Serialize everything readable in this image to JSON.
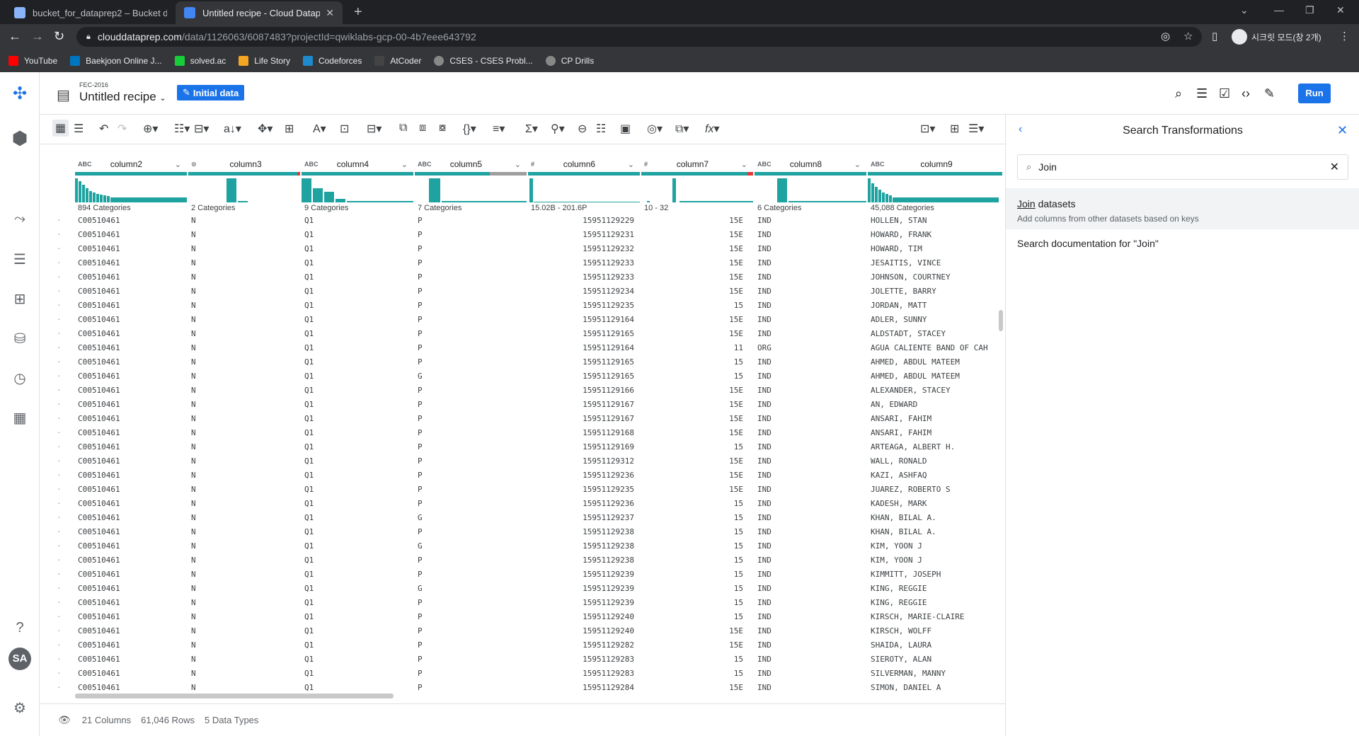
{
  "browser": {
    "tabs": [
      {
        "title": "bucket_for_dataprep2 – Bucket d",
        "active": false
      },
      {
        "title": "Untitled recipe - Cloud Dataprep",
        "active": true
      }
    ],
    "url_host": "clouddataprep.com",
    "url_path": "/data/1126063/6087483?projectId=qwiklabs-gcp-00-4b7eee643792",
    "profile_label": "시크릿 모드(창 2개)",
    "bookmarks": [
      "YouTube",
      "Baekjoon Online J...",
      "solved.ac",
      "Life Story",
      "Codeforces",
      "AtCoder",
      "CSES - CSES Probl...",
      "CP Drills"
    ]
  },
  "app": {
    "dataset_tag": "FEC-2016",
    "recipe_title": "Untitled recipe",
    "initial_data_label": "Initial data",
    "run_label": "Run",
    "avatar_initials": "SA"
  },
  "columns": [
    {
      "name": "column2",
      "type": "ABC",
      "summary": "894 Categories"
    },
    {
      "name": "column3",
      "type": "⊙",
      "summary": "2 Categories"
    },
    {
      "name": "column4",
      "type": "ABC",
      "summary": "9 Categories"
    },
    {
      "name": "column5",
      "type": "ABC",
      "summary": "7 Categories"
    },
    {
      "name": "column6",
      "type": "#",
      "summary": "15.02B - 201.6P"
    },
    {
      "name": "column7",
      "type": "#",
      "summary": "10 - 32"
    },
    {
      "name": "column8",
      "type": "ABC",
      "summary": "6 Categories"
    },
    {
      "name": "column9",
      "type": "ABC",
      "summary": "45,088 Categories"
    }
  ],
  "rows": [
    [
      "C00510461",
      "N",
      "Q1",
      "P",
      "15951129229",
      "15E",
      "IND",
      "HOLLEN, STAN"
    ],
    [
      "C00510461",
      "N",
      "Q1",
      "P",
      "15951129231",
      "15E",
      "IND",
      "HOWARD, FRANK"
    ],
    [
      "C00510461",
      "N",
      "Q1",
      "P",
      "15951129232",
      "15E",
      "IND",
      "HOWARD, TIM"
    ],
    [
      "C00510461",
      "N",
      "Q1",
      "P",
      "15951129233",
      "15E",
      "IND",
      "JESAITIS, VINCE"
    ],
    [
      "C00510461",
      "N",
      "Q1",
      "P",
      "15951129233",
      "15E",
      "IND",
      "JOHNSON, COURTNEY"
    ],
    [
      "C00510461",
      "N",
      "Q1",
      "P",
      "15951129234",
      "15E",
      "IND",
      "JOLETTE, BARRY"
    ],
    [
      "C00510461",
      "N",
      "Q1",
      "P",
      "15951129235",
      "15",
      "IND",
      "JORDAN, MATT"
    ],
    [
      "C00510461",
      "N",
      "Q1",
      "P",
      "15951129164",
      "15E",
      "IND",
      "ADLER, SUNNY"
    ],
    [
      "C00510461",
      "N",
      "Q1",
      "P",
      "15951129165",
      "15E",
      "IND",
      "ALDSTADT, STACEY"
    ],
    [
      "C00510461",
      "N",
      "Q1",
      "P",
      "15951129164",
      "11",
      "ORG",
      "AGUA CALIENTE BAND OF CAH"
    ],
    [
      "C00510461",
      "N",
      "Q1",
      "P",
      "15951129165",
      "15",
      "IND",
      "AHMED, ABDUL MATEEM"
    ],
    [
      "C00510461",
      "N",
      "Q1",
      "G",
      "15951129165",
      "15",
      "IND",
      "AHMED, ABDUL MATEEM"
    ],
    [
      "C00510461",
      "N",
      "Q1",
      "P",
      "15951129166",
      "15E",
      "IND",
      "ALEXANDER, STACEY"
    ],
    [
      "C00510461",
      "N",
      "Q1",
      "P",
      "15951129167",
      "15E",
      "IND",
      "AN, EDWARD"
    ],
    [
      "C00510461",
      "N",
      "Q1",
      "P",
      "15951129167",
      "15E",
      "IND",
      "ANSARI, FAHIM"
    ],
    [
      "C00510461",
      "N",
      "Q1",
      "P",
      "15951129168",
      "15E",
      "IND",
      "ANSARI, FAHIM"
    ],
    [
      "C00510461",
      "N",
      "Q1",
      "P",
      "15951129169",
      "15",
      "IND",
      "ARTEAGA, ALBERT H."
    ],
    [
      "C00510461",
      "N",
      "Q1",
      "P",
      "15951129312",
      "15E",
      "IND",
      "WALL, RONALD"
    ],
    [
      "C00510461",
      "N",
      "Q1",
      "P",
      "15951129236",
      "15E",
      "IND",
      "KAZI, ASHFAQ"
    ],
    [
      "C00510461",
      "N",
      "Q1",
      "P",
      "15951129235",
      "15E",
      "IND",
      "JUAREZ, ROBERTO S"
    ],
    [
      "C00510461",
      "N",
      "Q1",
      "P",
      "15951129236",
      "15",
      "IND",
      "KADESH, MARK"
    ],
    [
      "C00510461",
      "N",
      "Q1",
      "G",
      "15951129237",
      "15",
      "IND",
      "KHAN, BILAL A."
    ],
    [
      "C00510461",
      "N",
      "Q1",
      "P",
      "15951129238",
      "15",
      "IND",
      "KHAN, BILAL A."
    ],
    [
      "C00510461",
      "N",
      "Q1",
      "G",
      "15951129238",
      "15",
      "IND",
      "KIM, YOON J"
    ],
    [
      "C00510461",
      "N",
      "Q1",
      "P",
      "15951129238",
      "15",
      "IND",
      "KIM, YOON J"
    ],
    [
      "C00510461",
      "N",
      "Q1",
      "P",
      "15951129239",
      "15",
      "IND",
      "KIMMITT, JOSEPH"
    ],
    [
      "C00510461",
      "N",
      "Q1",
      "G",
      "15951129239",
      "15",
      "IND",
      "KING, REGGIE"
    ],
    [
      "C00510461",
      "N",
      "Q1",
      "P",
      "15951129239",
      "15",
      "IND",
      "KING, REGGIE"
    ],
    [
      "C00510461",
      "N",
      "Q1",
      "P",
      "15951129240",
      "15",
      "IND",
      "KIRSCH, MARIE-CLAIRE"
    ],
    [
      "C00510461",
      "N",
      "Q1",
      "P",
      "15951129240",
      "15E",
      "IND",
      "KIRSCH, WOLFF"
    ],
    [
      "C00510461",
      "N",
      "Q1",
      "P",
      "15951129282",
      "15E",
      "IND",
      "SHAIDA, LAURA"
    ],
    [
      "C00510461",
      "N",
      "Q1",
      "P",
      "15951129283",
      "15",
      "IND",
      "SIEROTY, ALAN"
    ],
    [
      "C00510461",
      "N",
      "Q1",
      "P",
      "15951129283",
      "15",
      "IND",
      "SILVERMAN, MANNY"
    ],
    [
      "C00510461",
      "N",
      "Q1",
      "P",
      "15951129284",
      "15E",
      "IND",
      "SIMON, DANIEL A"
    ]
  ],
  "status": {
    "columns": "21 Columns",
    "rows": "61,046 Rows",
    "types": "5 Data Types"
  },
  "panel": {
    "title": "Search Transformations",
    "search_value": "Join",
    "result_title_keyword": "Join",
    "result_title_rest": " datasets",
    "result_desc": "Add columns from other datasets based on keys",
    "doc_link": "Search documentation for \"Join\""
  }
}
